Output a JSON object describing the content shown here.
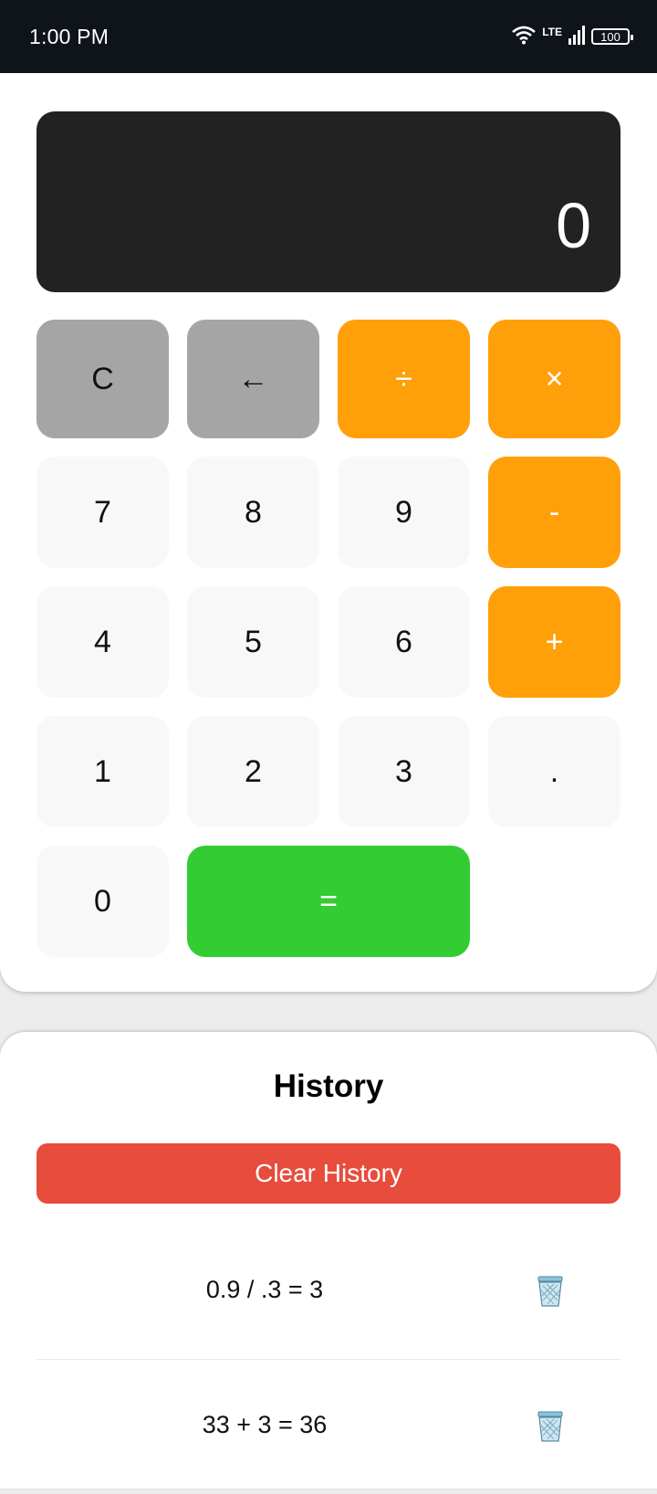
{
  "status_bar": {
    "time": "1:00 PM",
    "network": "LTE",
    "battery": "100"
  },
  "calculator": {
    "display": "0",
    "keys": {
      "clear": "C",
      "backspace": "←",
      "divide": "÷",
      "multiply": "×",
      "seven": "7",
      "eight": "8",
      "nine": "9",
      "minus": "-",
      "four": "4",
      "five": "5",
      "six": "6",
      "plus": "+",
      "one": "1",
      "two": "2",
      "three": "3",
      "decimal": ".",
      "zero": "0",
      "equals": "="
    }
  },
  "history": {
    "title": "History",
    "clear_label": "Clear History",
    "entries": [
      {
        "expression": "0.9 / .3 = 3",
        "icon": "trash-icon"
      },
      {
        "expression": "33 + 3 = 36",
        "icon": "trash-icon"
      }
    ]
  },
  "colors": {
    "operator": "#ff9f0a",
    "function": "#a5a5a5",
    "equals": "#33cc33",
    "clear_history": "#e74c3c",
    "display": "#222222"
  }
}
